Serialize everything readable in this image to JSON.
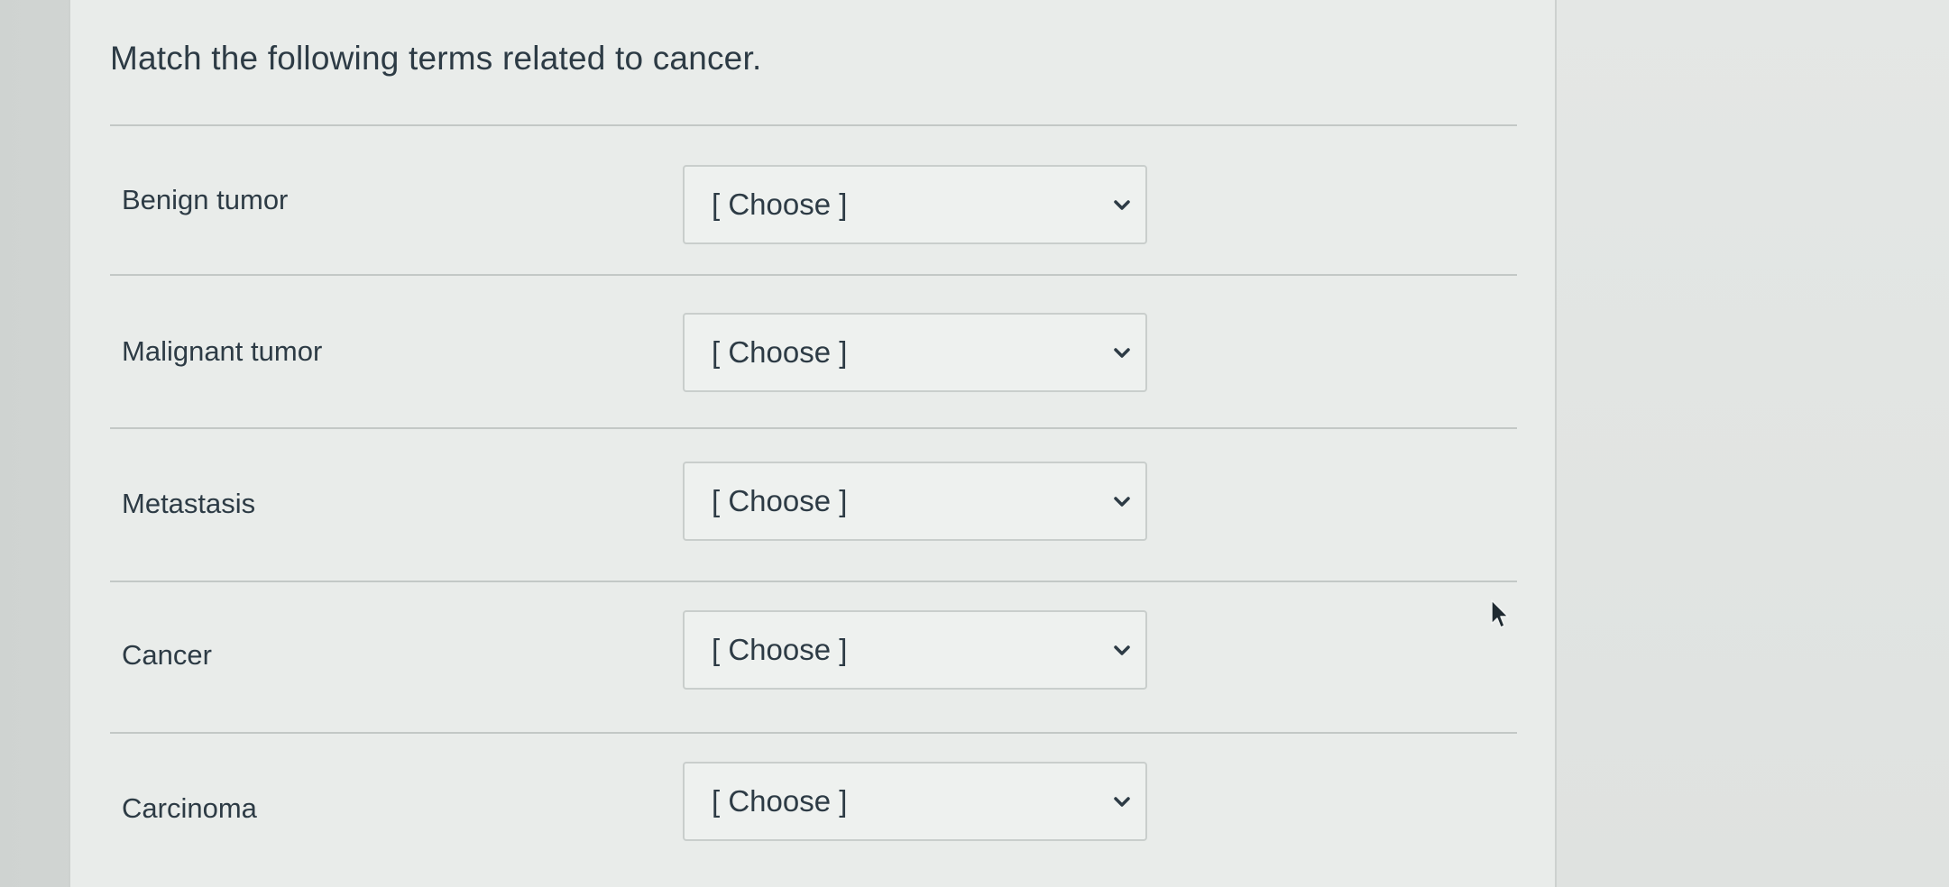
{
  "question": {
    "title": "Match the following terms related to cancer."
  },
  "rows": [
    {
      "label": "Benign tumor",
      "select_value": "[ Choose ]"
    },
    {
      "label": "Malignant tumor",
      "select_value": "[ Choose ]"
    },
    {
      "label": "Metastasis",
      "select_value": "[ Choose ]"
    },
    {
      "label": "Cancer",
      "select_value": "[ Choose ]"
    },
    {
      "label": "Carcinoma",
      "select_value": "[ Choose ]"
    }
  ],
  "icons": {
    "dropdown": "chevron-down-icon",
    "pointer": "mouse-cursor-icon"
  },
  "colors": {
    "text": "#2d3b45",
    "panel": "#e9ecea",
    "border": "#c9cecc"
  }
}
